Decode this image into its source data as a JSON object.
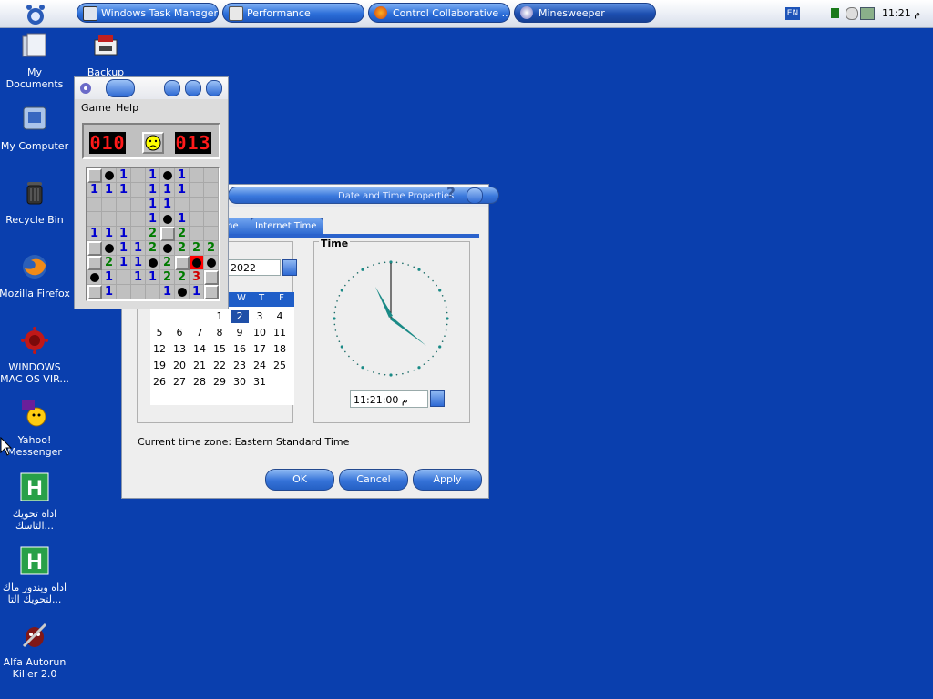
{
  "taskbar": {
    "tasks": [
      {
        "label": "Windows Task Manager"
      },
      {
        "label": "Performance"
      },
      {
        "label": "Control Collaborative ..."
      },
      {
        "label": "Minesweeper"
      }
    ],
    "language": "EN",
    "clock": "11:21 م"
  },
  "desktop": {
    "icons": [
      {
        "label": "My Documents"
      },
      {
        "label": "Backup"
      },
      {
        "label": "My Computer"
      },
      {
        "label": "Recycle Bin"
      },
      {
        "label": "Mozilla Firefox"
      },
      {
        "label": "WINDOWS MAC OS VIR..."
      },
      {
        "label": "Yahoo! Messenger"
      },
      {
        "label": "اداه تحويك التاسك..."
      },
      {
        "label": "اداه ويندوز ماك لتحويك التا..."
      },
      {
        "label": "Alfa Autorun Killer 2.0"
      }
    ]
  },
  "datetime": {
    "title": "Date and Time Properties",
    "tabs": [
      "one",
      "Internet Time"
    ],
    "year": "2022",
    "weekdays_visible": [
      "W",
      "T",
      "F"
    ],
    "days": [
      "1",
      "2",
      "3",
      "4",
      "5",
      "6",
      "7",
      "8",
      "9",
      "10",
      "11",
      "12",
      "13",
      "14",
      "15",
      "16",
      "17",
      "18",
      "19",
      "20",
      "21",
      "22",
      "23",
      "24",
      "25",
      "26",
      "27",
      "28",
      "29",
      "30",
      "31"
    ],
    "selected_day": "2",
    "time_legend": "Time",
    "time_value": "11:21:00 م",
    "timezone_label": "Current time zone:  Eastern Standard Time",
    "buttons": {
      "ok": "OK",
      "cancel": "Cancel",
      "apply": "Apply"
    },
    "help_glyph": "?"
  },
  "minesweeper": {
    "menu": {
      "game": "Game",
      "help": "Help"
    },
    "mines_left": "010",
    "timer": "013",
    "grid": [
      "C*1.1*1..",
      "111.111..",
      "....11...",
      "....1*1..",
      "111.2C2..",
      "C*112*222",
      "C211*2CX*",
      "*1.11223C",
      "C1...1*1C"
    ]
  }
}
